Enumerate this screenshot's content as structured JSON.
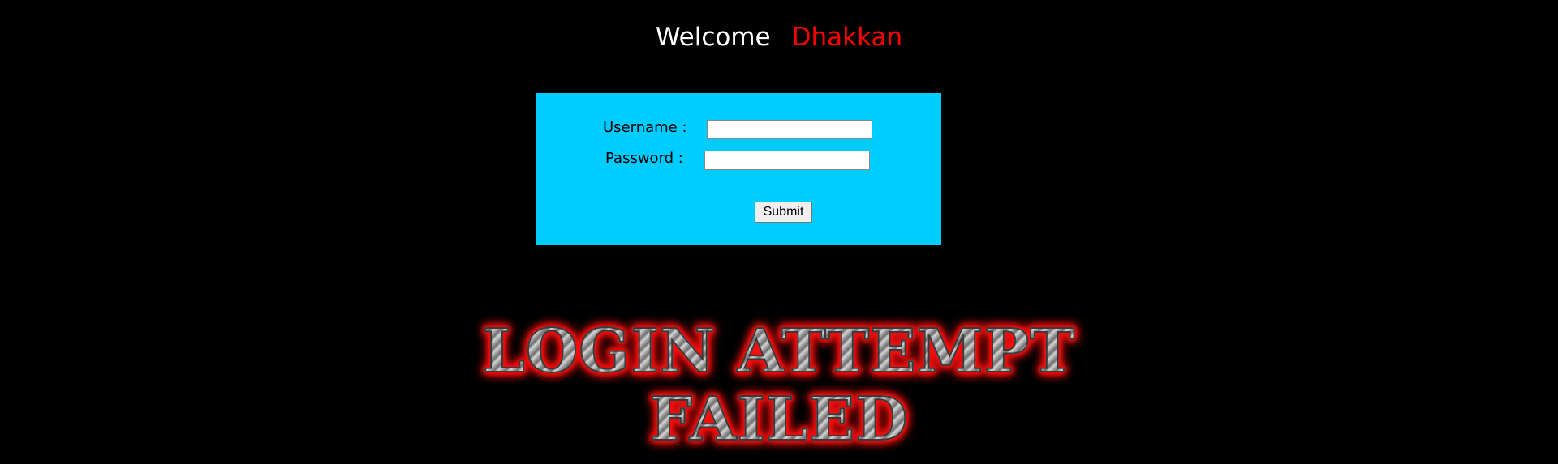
{
  "header": {
    "welcome_text": "Welcome",
    "user_name": "Dhakkan"
  },
  "login_form": {
    "username_label": "Username :",
    "password_label": "Password :",
    "username_value": "",
    "password_value": "",
    "submit_label": "Submit"
  },
  "result_banner": {
    "line1": "LOGIN ATTEMPT",
    "line2": "FAILED"
  },
  "colors": {
    "background": "#000000",
    "form_background": "#00ccff",
    "user_name": "#ff0000",
    "banner_glow": "#ff0000"
  }
}
